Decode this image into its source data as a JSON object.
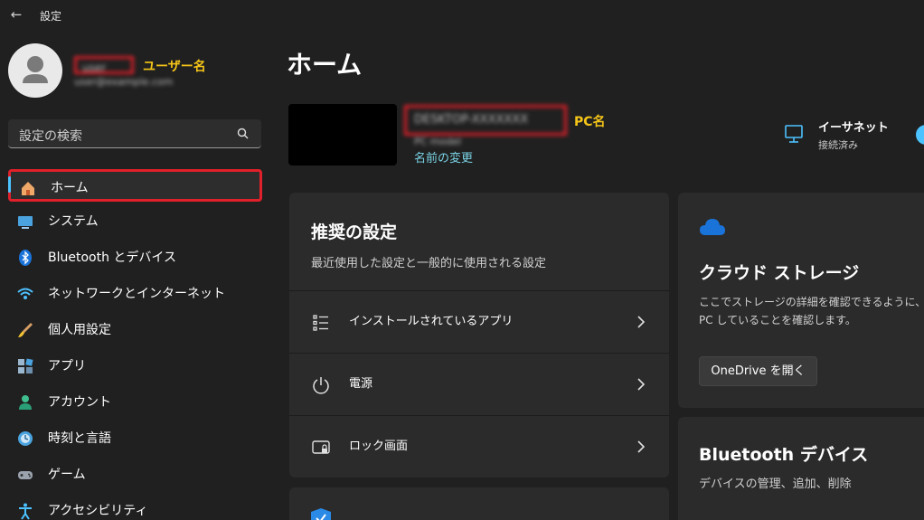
{
  "titlebar": {
    "title": "設定",
    "back_icon": "back-arrow-icon"
  },
  "profile": {
    "username": "user",
    "email": "user@example.com",
    "username_annotation": "ユーザー名"
  },
  "search": {
    "placeholder": "設定の検索",
    "icon": "search-icon"
  },
  "nav": {
    "items": [
      {
        "label": "ホーム",
        "icon": "home-icon",
        "active": true
      },
      {
        "label": "システム",
        "icon": "system-icon"
      },
      {
        "label": "Bluetooth とデバイス",
        "icon": "bluetooth-icon"
      },
      {
        "label": "ネットワークとインターネット",
        "icon": "wifi-icon"
      },
      {
        "label": "個人用設定",
        "icon": "brush-icon"
      },
      {
        "label": "アプリ",
        "icon": "apps-icon"
      },
      {
        "label": "アカウント",
        "icon": "account-icon"
      },
      {
        "label": "時刻と言語",
        "icon": "time-language-icon"
      },
      {
        "label": "ゲーム",
        "icon": "gamepad-icon"
      },
      {
        "label": "アクセシビリティ",
        "icon": "accessibility-icon"
      }
    ]
  },
  "main": {
    "title": "ホーム",
    "pc": {
      "name": "DESKTOP-XXXXXXX",
      "model": "PC model",
      "name_annotation": "PC名",
      "rename_link": "名前の変更"
    },
    "network": {
      "title": "イーサネット",
      "status": "接続済み",
      "icon": "ethernet-icon"
    },
    "recommended": {
      "title": "推奨の設定",
      "subtitle": "最近使用した設定と一般的に使用される設定",
      "rows": [
        {
          "label": "インストールされているアプリ",
          "icon": "installed-apps-icon"
        },
        {
          "label": "電源",
          "icon": "power-icon"
        },
        {
          "label": "ロック画面",
          "icon": "lock-screen-icon"
        }
      ]
    },
    "cloud": {
      "title": "クラウド ストレージ",
      "description": "ここでストレージの詳細を確認できるように、PC していることを確認します。",
      "button": "OneDrive を開く",
      "icon": "cloud-icon"
    },
    "bluetooth": {
      "title": "Bluetooth デバイス",
      "subtitle": "デバイスの管理、追加、削除"
    }
  },
  "colors": {
    "accent": "#4cc2ff",
    "annotation": "#f5c518",
    "highlight_box": "#e0202a",
    "background": "#202020",
    "card": "#2b2b2b"
  }
}
